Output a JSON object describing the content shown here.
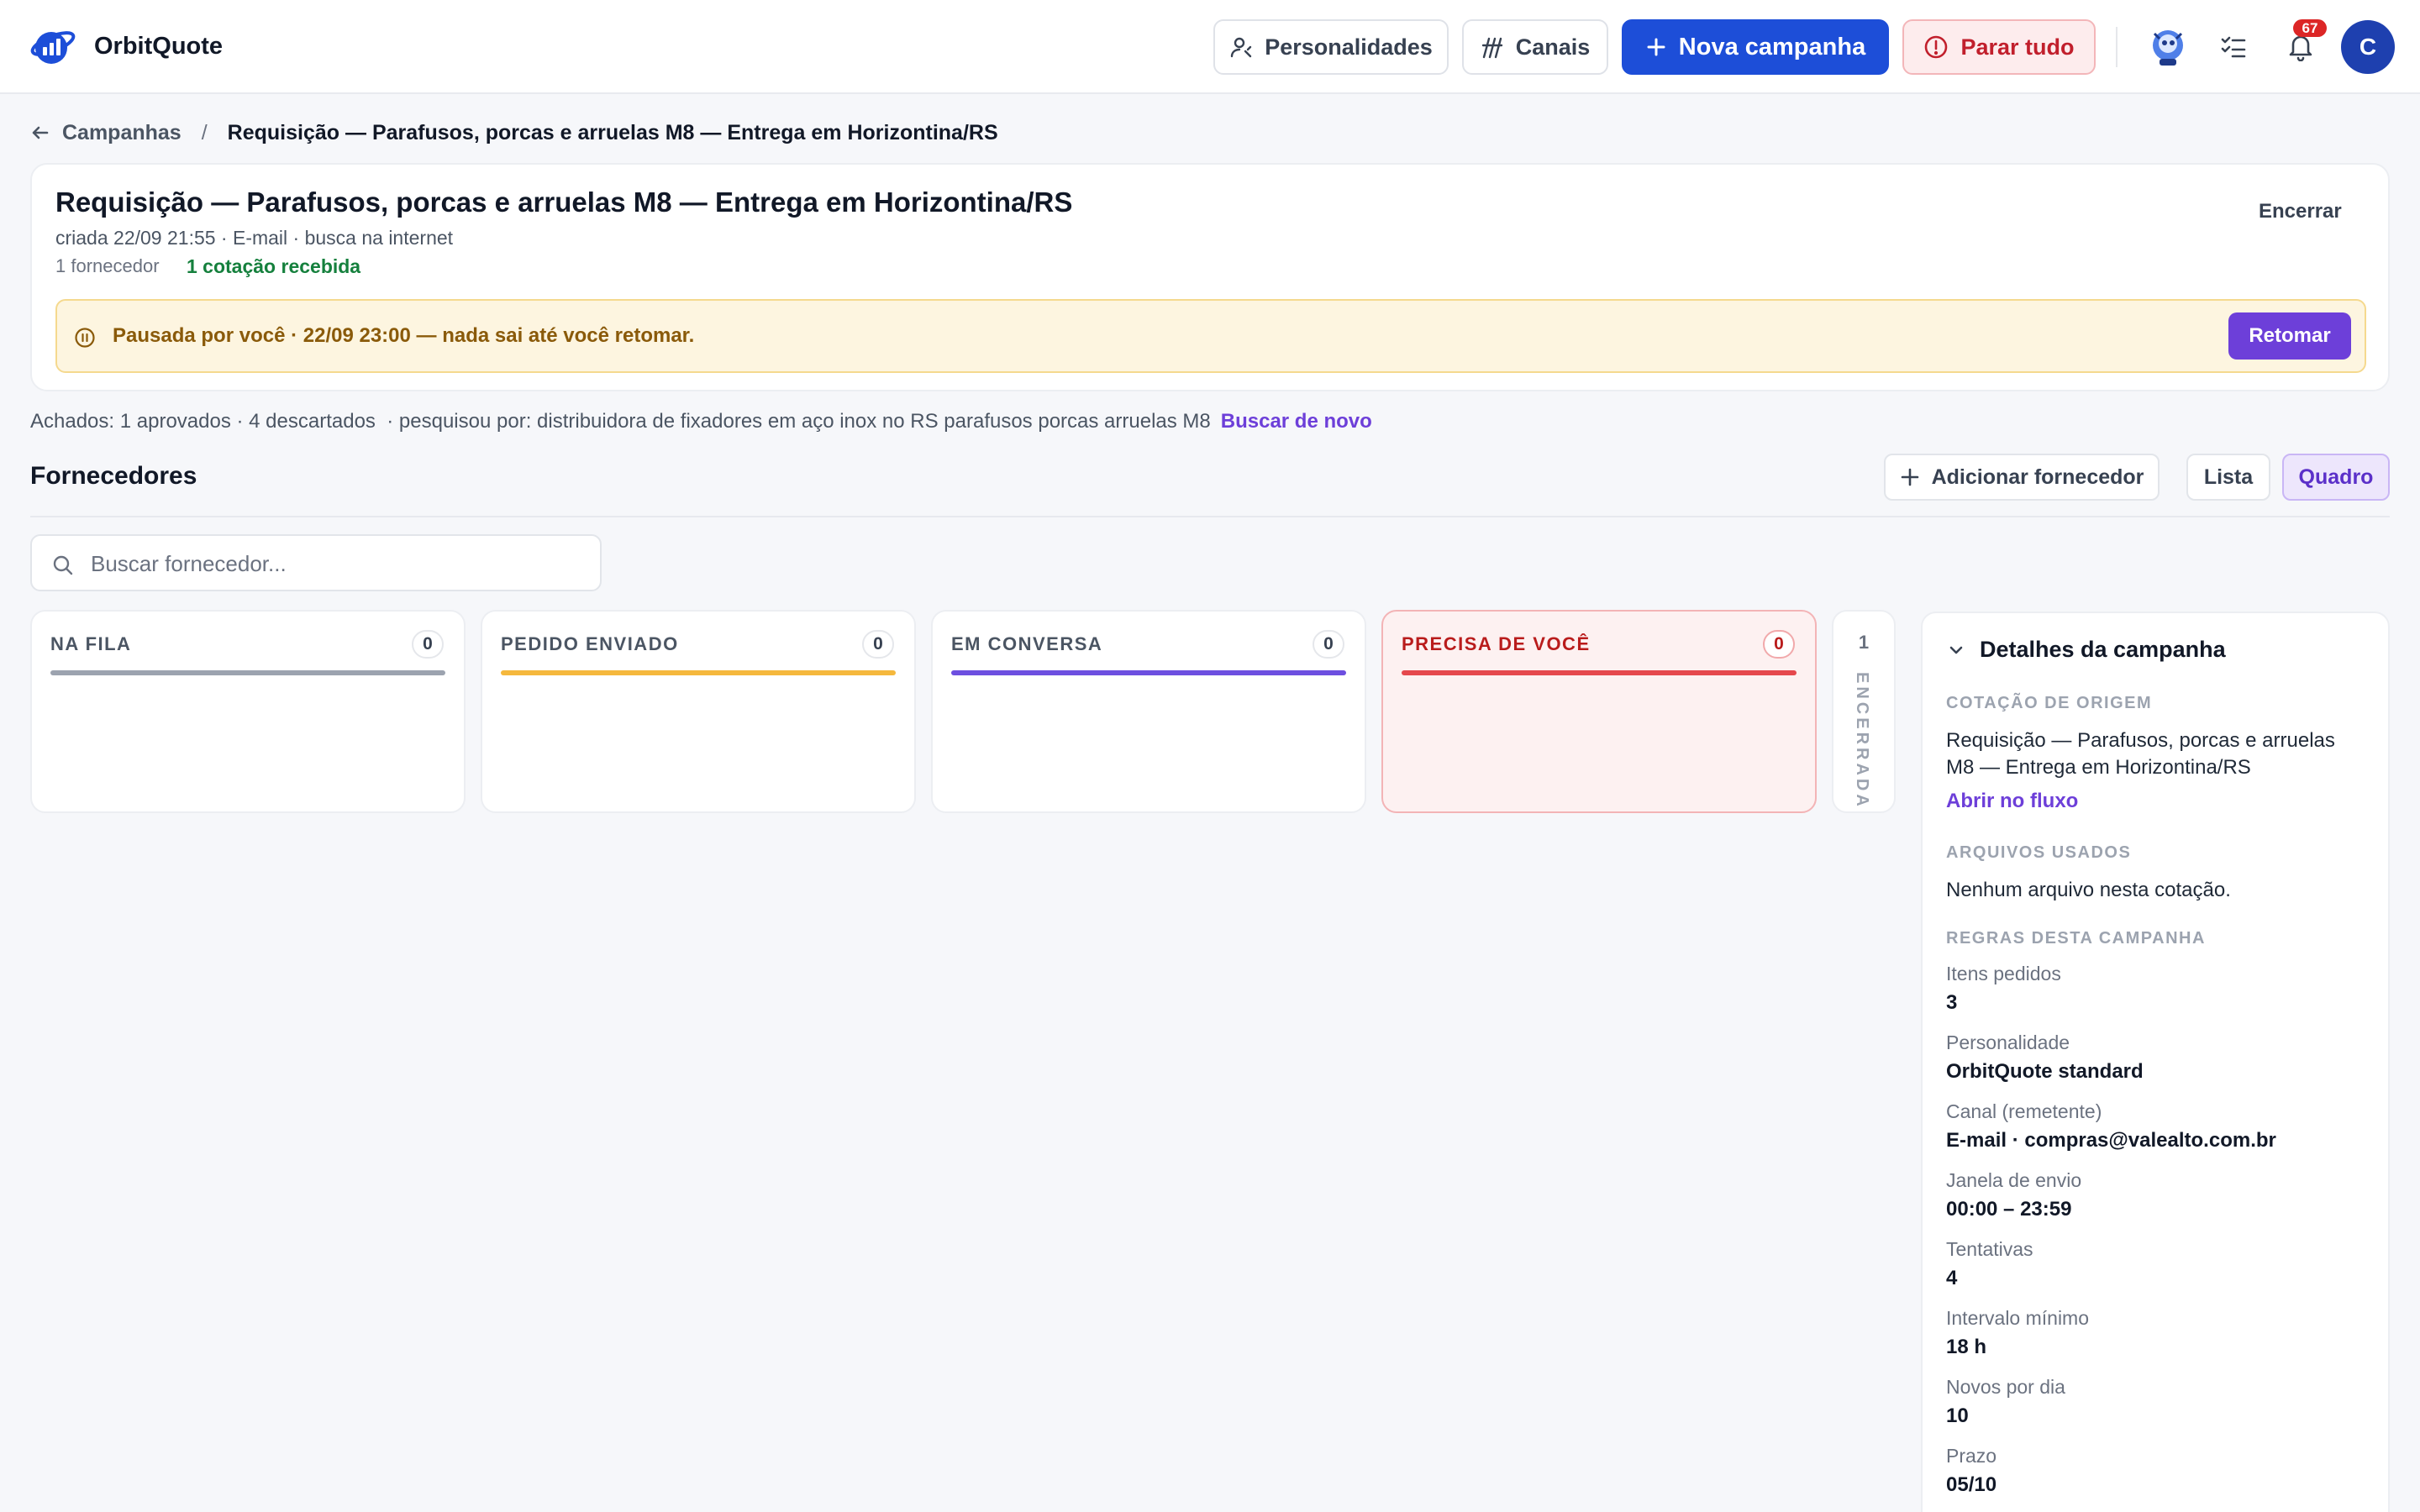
{
  "app": {
    "name": "OrbitQuote"
  },
  "header": {
    "personalities_label": "Personalidades",
    "channels_label": "Canais",
    "new_campaign_label": "Nova campanha",
    "stop_all_label": "Parar tudo",
    "notifications_count": "67",
    "avatar_initial": "C"
  },
  "breadcrumb": {
    "back_label": "Campanhas",
    "separator": "/",
    "current": "Requisição — Parafusos, porcas e arruelas M8 — Entrega em Horizontina/RS"
  },
  "campaign": {
    "title": "Requisição — Parafusos, porcas e arruelas M8 — Entrega em Horizontina/RS",
    "meta": "criada 22/09 21:55 · E-mail · busca na internet",
    "suppliers_count": "1 fornecedor",
    "quotes_received": "1 cotação recebida",
    "end_label": "Encerrar",
    "paused_text": "Pausada por você · 22/09 23:00 — nada sai até você retomar.",
    "resume_label": "Retomar"
  },
  "found": {
    "summary": "Achados: 1 aprovados · 4 descartados",
    "searched_for": "  · pesquisou por: distribuidora de fixadores em aço inox no RS parafusos porcas arruelas M8",
    "search_again_label": "Buscar de novo"
  },
  "suppliers": {
    "title": "Fornecedores",
    "add_label": "Adicionar fornecedor",
    "view_list_label": "Lista",
    "view_board_label": "Quadro",
    "search_placeholder": "Buscar fornecedor..."
  },
  "board": {
    "columns": [
      {
        "name": "NA FILA",
        "count": "0",
        "color": "#9ca3af"
      },
      {
        "name": "PEDIDO ENVIADO",
        "count": "0",
        "color": "#f5b83d"
      },
      {
        "name": "EM CONVERSA",
        "count": "0",
        "color": "#6d4fe0"
      },
      {
        "name": "PRECISA DE VOCÊ",
        "count": "0",
        "color": "#e5484d"
      }
    ],
    "collapsed": {
      "name": "ENCERRADA",
      "count": "1"
    }
  },
  "details": {
    "title": "Detalhes da campanha",
    "origin_label": "COTAÇÃO DE ORIGEM",
    "origin_text": "Requisição — Parafusos, porcas e arruelas M8 — Entrega em Horizontina/RS",
    "open_flow_label": "Abrir no fluxo",
    "files_label": "ARQUIVOS USADOS",
    "files_text": "Nenhum arquivo nesta cotação.",
    "rules_label": "REGRAS DESTA CAMPANHA",
    "rules": [
      {
        "key": "Itens pedidos",
        "value": "3"
      },
      {
        "key": "Personalidade",
        "value": "OrbitQuote standard"
      },
      {
        "key": "Canal (remetente)",
        "value": "E-mail · compras@valealto.com.br"
      },
      {
        "key": "Janela de envio",
        "value": "00:00 – 23:59"
      },
      {
        "key": "Tentativas",
        "value": "4"
      },
      {
        "key": "Intervalo mínimo",
        "value": "18 h"
      },
      {
        "key": "Novos por dia",
        "value": "10"
      },
      {
        "key": "Prazo",
        "value": "05/10"
      }
    ]
  },
  "colors": {
    "primary": "#1d4ed8",
    "accent_purple": "#6d3fd9",
    "danger": "#c11f2c",
    "success": "#15803d",
    "warning_bg": "#fdf5e0"
  }
}
